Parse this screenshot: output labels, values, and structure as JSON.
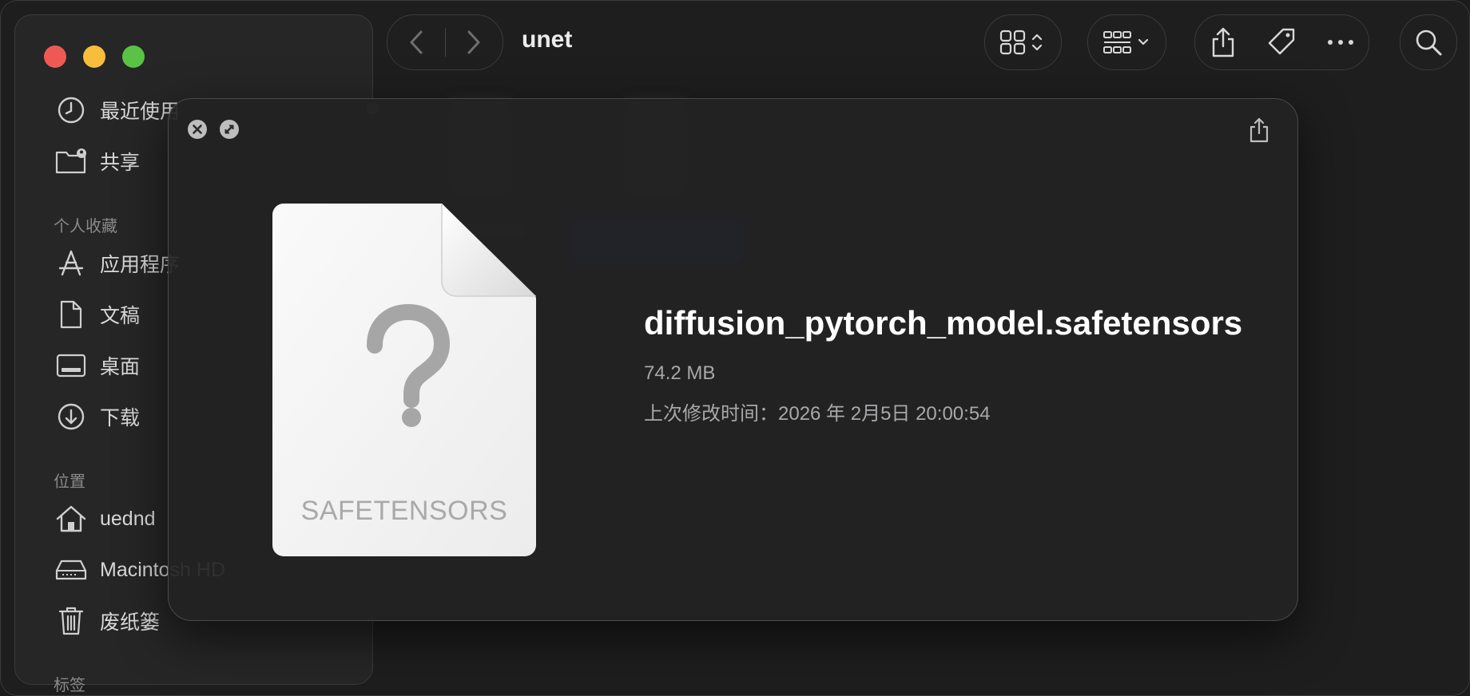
{
  "window": {
    "title": "unet"
  },
  "sidebar": {
    "recents_label": "最近使用",
    "shared_label": "共享",
    "favorites_heading": "个人收藏",
    "applications_label": "应用程序",
    "documents_label": "文稿",
    "desktop_label": "桌面",
    "downloads_label": "下载",
    "locations_heading": "位置",
    "home_label": "uednd",
    "disk_label": "Macintosh HD",
    "trash_label": "废纸篓",
    "tags_heading": "标签"
  },
  "quicklook": {
    "file_name": "diffusion_pytorch_model.safetensors",
    "file_size": "74.2 MB",
    "modified": "上次修改时间：2026 年 2月5日 20:00:54",
    "doc_type_label": "SAFETENSORS"
  },
  "colors": {
    "close": "#ee5a53",
    "minimize": "#f6be3b",
    "zoom": "#5ac345",
    "selection": "#1a3a8a"
  }
}
